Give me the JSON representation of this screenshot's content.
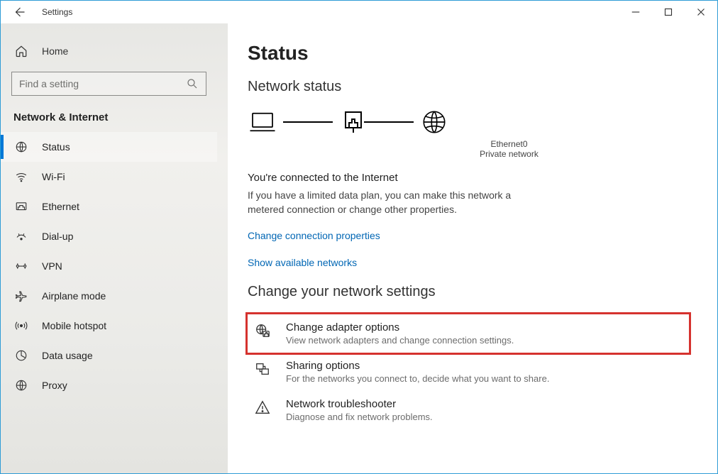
{
  "window": {
    "title": "Settings"
  },
  "sidebar": {
    "home": "Home",
    "search_placeholder": "Find a setting",
    "category": "Network & Internet",
    "items": [
      {
        "label": "Status"
      },
      {
        "label": "Wi-Fi"
      },
      {
        "label": "Ethernet"
      },
      {
        "label": "Dial-up"
      },
      {
        "label": "VPN"
      },
      {
        "label": "Airplane mode"
      },
      {
        "label": "Mobile hotspot"
      },
      {
        "label": "Data usage"
      },
      {
        "label": "Proxy"
      }
    ]
  },
  "main": {
    "title": "Status",
    "section1": "Network status",
    "diagram": {
      "adapter": "Ethernet0",
      "network_type": "Private network"
    },
    "connected_title": "You're connected to the Internet",
    "connected_sub": "If you have a limited data plan, you can make this network a metered connection or change other properties.",
    "link_change_props": "Change connection properties",
    "link_show_nets": "Show available networks",
    "section2": "Change your network settings",
    "cards": [
      {
        "title": "Change adapter options",
        "desc": "View network adapters and change connection settings."
      },
      {
        "title": "Sharing options",
        "desc": "For the networks you connect to, decide what you want to share."
      },
      {
        "title": "Network troubleshooter",
        "desc": "Diagnose and fix network problems."
      }
    ]
  }
}
